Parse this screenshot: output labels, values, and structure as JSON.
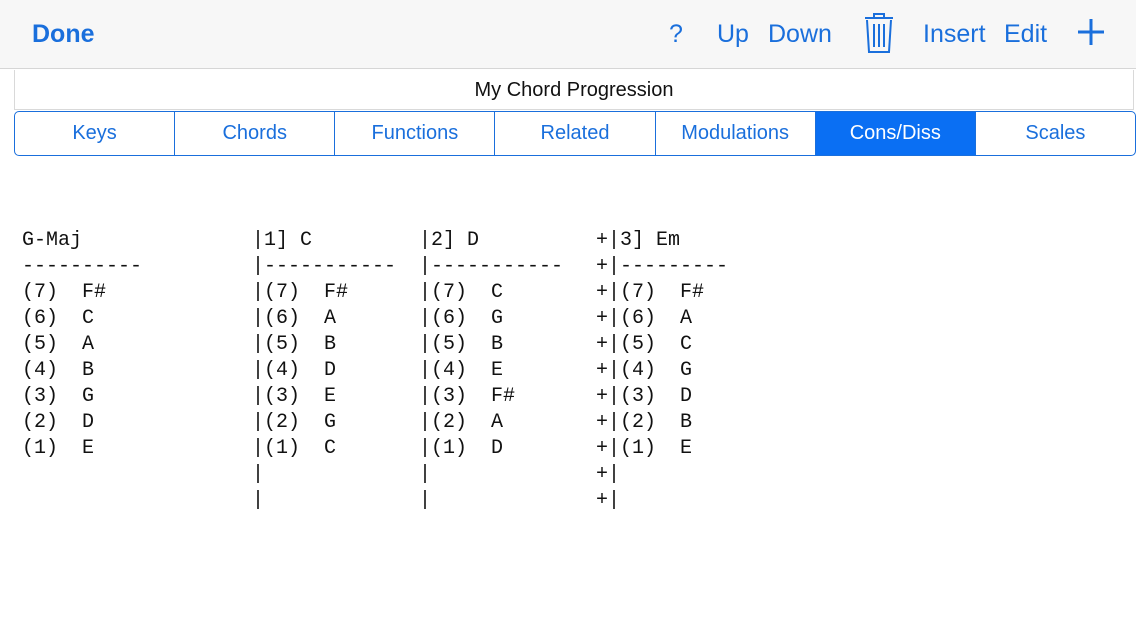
{
  "toolbar": {
    "done_label": "Done",
    "help_label": "?",
    "up_label": "Up",
    "down_label": "Down",
    "trash_icon": "trash-icon",
    "insert_label": "Insert",
    "edit_label": "Edit",
    "add_icon": "plus-icon",
    "accent_color": "#1a6fdc"
  },
  "progression_title": "My Chord Progression",
  "tabs": [
    {
      "label": "Keys",
      "active": false
    },
    {
      "label": "Chords",
      "active": false
    },
    {
      "label": "Functions",
      "active": false
    },
    {
      "label": "Related",
      "active": false
    },
    {
      "label": "Modulations",
      "active": false
    },
    {
      "label": "Cons/Diss",
      "active": true
    },
    {
      "label": "Scales",
      "active": false
    }
  ],
  "columns": [
    {
      "lines": [
        "G-Maj",
        "----------",
        "(7)  F#",
        "(6)  C",
        "(5)  A",
        "(4)  B",
        "(3)  G",
        "(2)  D",
        "(1)  E"
      ]
    },
    {
      "lines": [
        "|1] C",
        "|-----------",
        "|(7)  F#",
        "|(6)  A",
        "|(5)  B",
        "|(4)  D",
        "|(3)  E",
        "|(2)  G",
        "|(1)  C",
        "|",
        "|"
      ]
    },
    {
      "lines": [
        "|2] D",
        "|-----------",
        "|(7)  C",
        "|(6)  G",
        "|(5)  B",
        "|(4)  E",
        "|(3)  F#",
        "|(2)  A",
        "|(1)  D",
        "|",
        "|"
      ]
    },
    {
      "lines": [
        "+|3] Em",
        "+|---------",
        "+|(7)  F#",
        "+|(6)  A",
        "+|(5)  C",
        "+|(4)  G",
        "+|(3)  D",
        "+|(2)  B",
        "+|(1)  E",
        "+|",
        "+|"
      ]
    }
  ]
}
